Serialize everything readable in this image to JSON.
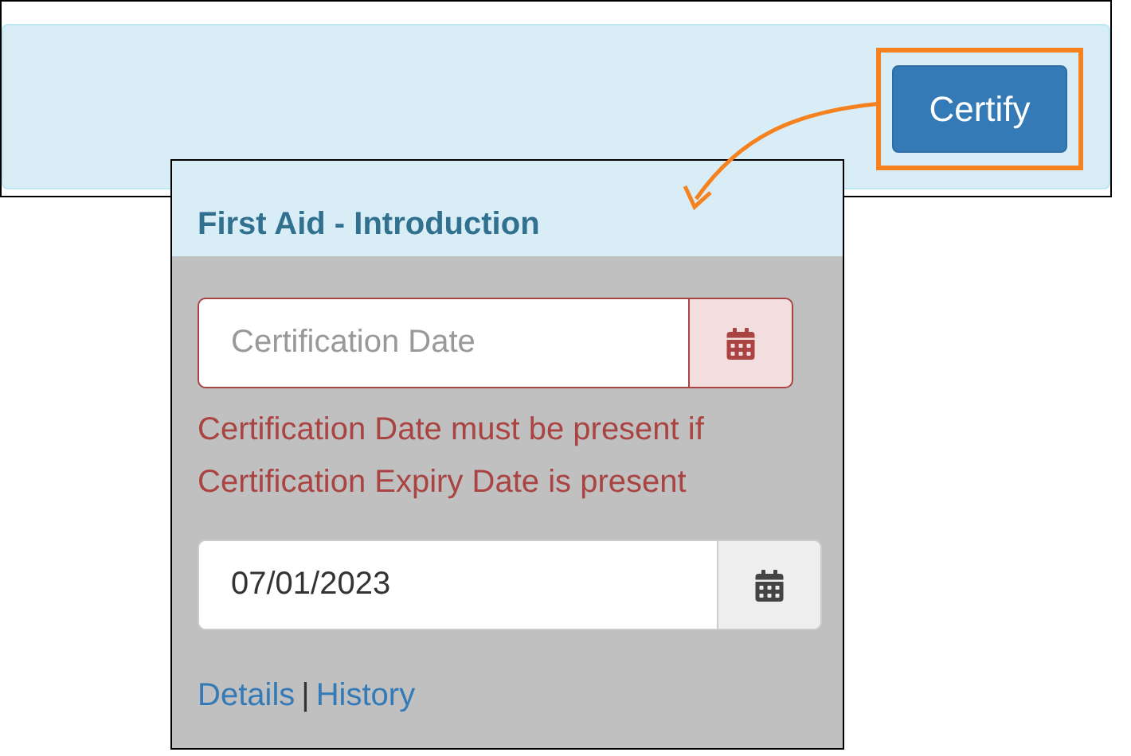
{
  "toolbar": {
    "button": "Certify",
    "highlighted": true
  },
  "popover": {
    "title": "First Aid - Introduction",
    "fields": [
      {
        "placeholder": "Certification Date",
        "error": true
      },
      {
        "value": "07/01/2023",
        "error": false
      }
    ],
    "error_message": "Certification Date must be present if Certification Expiry Date is present",
    "links": [
      "Details",
      "History"
    ],
    "separator": "|"
  }
}
